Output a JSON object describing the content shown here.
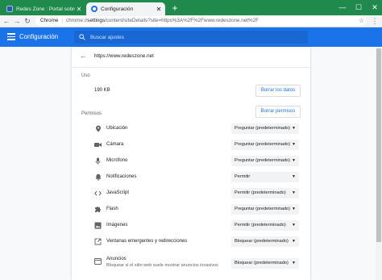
{
  "tabs": [
    {
      "title": "Redes Zone : Portal sobre telecom",
      "icon": "redeszone-favicon"
    },
    {
      "title": "Configuración",
      "icon": "settings-favicon"
    }
  ],
  "toolbar": {
    "chip": "Chrome",
    "url_scheme": "chrome://",
    "url_host": "settings",
    "url_rest": "/content/siteDetails?site=https%3A%2F%2Fwww.redeszone.net%2F"
  },
  "settings": {
    "title": "Configuración",
    "search_placeholder": "Buscar ajustes"
  },
  "site": {
    "url": "https://www.redeszone.net",
    "usage_label": "Uso",
    "usage_value": "190 KB",
    "clear_data_label": "Borrar los datos",
    "permissions_label": "Permisos",
    "reset_permissions_label": "Borrar permisos"
  },
  "permissions": [
    {
      "label": "Ubicación",
      "value": "Preguntar (predeterminado)",
      "icon": "location-icon"
    },
    {
      "label": "Cámara",
      "value": "Preguntar (predeterminado)",
      "icon": "camera-icon"
    },
    {
      "label": "Micrófono",
      "value": "Preguntar (predeterminado)",
      "icon": "microphone-icon"
    },
    {
      "label": "Notificaciones",
      "value": "Permitir",
      "icon": "bell-icon"
    },
    {
      "label": "JavaScript",
      "value": "Permitir (predeterminado)",
      "icon": "code-icon"
    },
    {
      "label": "Flash",
      "value": "Preguntar (predeterminado)",
      "icon": "puzzle-icon"
    },
    {
      "label": "Imágenes",
      "value": "Permitir (predeterminado)",
      "icon": "image-icon"
    },
    {
      "label": "Ventanas emergentes y redirecciones",
      "value": "Bloquear (predeterminado)",
      "icon": "popup-icon"
    },
    {
      "label": "Anuncios",
      "sublabel": "Bloquear si el sitio web suele mostrar anuncios invasivos",
      "value": "Bloquear (predeterminado)",
      "icon": "ads-icon"
    }
  ],
  "colors": {
    "tabstrip": "#1f8a4c",
    "accent": "#1a73e8",
    "header": "#1a73e8"
  }
}
